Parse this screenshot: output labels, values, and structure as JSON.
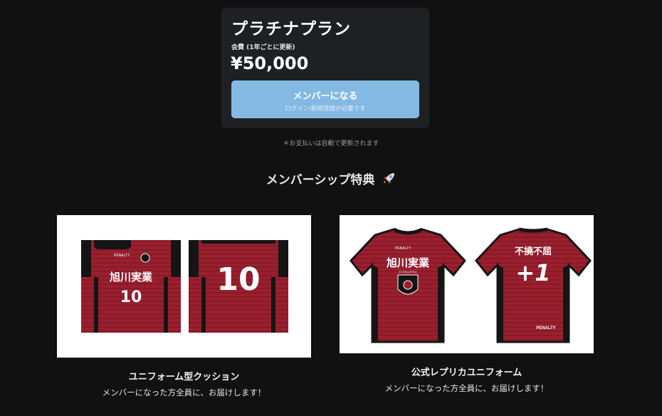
{
  "plan": {
    "name": "プラチナプラン",
    "fee_label": "会費 (1年ごとに更新)",
    "price": "¥50,000",
    "join_button": "メンバーになる",
    "join_note": "ログイン/新規登録が必要です",
    "autorenew_note": "＊お支払いは自動で更新されます"
  },
  "benefits_section": {
    "title": "メンバーシップ特典",
    "title_icon": "rocket-icon",
    "items": [
      {
        "title": "ユニフォーム型クッション",
        "description": "メンバーになった方全員に、お届けします！",
        "front_text": "旭川実業",
        "front_number": "10",
        "back_number": "10",
        "brand": "PENALTY"
      },
      {
        "title": "公式レプリカユニフォーム",
        "description": "メンバーになった方全員に、お届けします！",
        "front_text": "旭川実業",
        "back_text": "不撓不屈",
        "back_number": "+1",
        "brand": "PENALTY",
        "emblem_text": "KYOKUJITSU"
      }
    ]
  },
  "colors": {
    "background": "#111111",
    "card": "#1f2024",
    "button": "#84b9e3",
    "jersey_red": "#9b1f2e",
    "jersey_black": "#151515"
  }
}
